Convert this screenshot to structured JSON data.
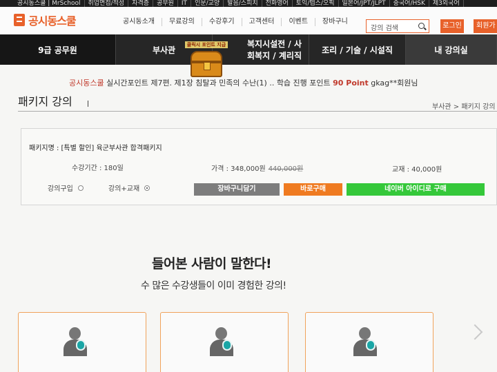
{
  "top_categories": [
    "공시동스쿨 | MrSchool",
    "취업면접/적성",
    "자격증",
    "공무원",
    "IT",
    "인문/교양",
    "발음/스피치",
    "전화영어",
    "토익/텝스/오픽",
    "일본어/JPT/JLPT",
    "중국어/HSK",
    "제3외국어"
  ],
  "header": {
    "logo_text": "공시동스쿨",
    "nav": [
      "공시동소개",
      "무료강의",
      "수강후기",
      "고객센터",
      "이벤트",
      "장바구니"
    ],
    "search_placeholder": "강의 검색",
    "login_label": "로그인",
    "join_label": "회원가입"
  },
  "main_nav": [
    "9급 공무원",
    "부사관",
    "복지시설전 / 사회복지 / 계리직",
    "조리 / 기술 / 시설직",
    "내 강의실"
  ],
  "treasure_label": "클릭시 포인트 지급",
  "ticker": {
    "brand": "공시동스쿨",
    "text1": " 실시간포인트 제7편. 제1장 ",
    "text2": " 침탈과 민족의 수난(1) .. 학습 진행 포인트 ",
    "points": "90 Point",
    "user": " gkag**회원님"
  },
  "page": {
    "title": "패키지 강의",
    "breadcrumb": "부사관 > 패키지 강의"
  },
  "package": {
    "name": "패키지명 : [특별 할인] 육군부사관 합격패키지",
    "period": "수강기간 : 180일",
    "price_label": "가격 : 348,000원",
    "price_original": "440,000원",
    "book": "교재 : 40,000원",
    "options": [
      {
        "label": "강의구입",
        "selected": false
      },
      {
        "label": "강의+교재",
        "selected": true
      }
    ],
    "cart_label": "장바구니담기",
    "buy_label": "바로구매",
    "naver_label": "네이버 아이디로 구매"
  },
  "testimonials": {
    "title": "들어본 사람이 말한다!",
    "subtitle": "수 많은 수강생들이 이미 경험한 강의!"
  },
  "colors": {
    "brand": "#e8612a",
    "nav_bg": "#262626",
    "cart": "#7d7d7d",
    "buy": "#ef7b21",
    "naver": "#35c83a"
  }
}
